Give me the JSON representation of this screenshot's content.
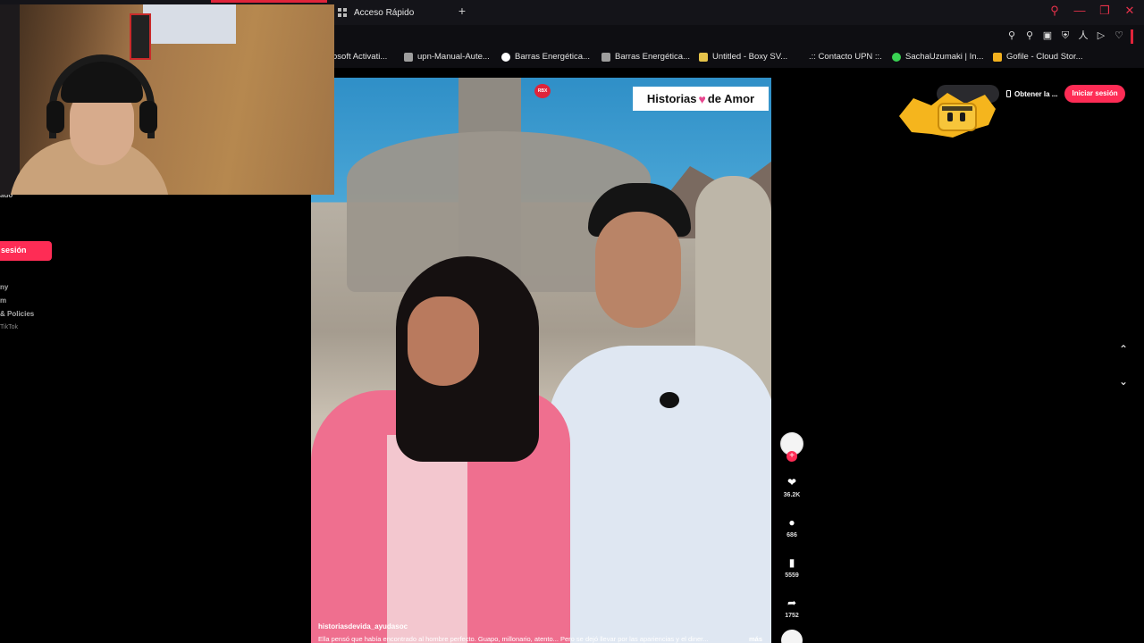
{
  "browser": {
    "tab_label": "Acceso Rápido",
    "new_tab": "+",
    "bookmarks": [
      {
        "label": "osoft Activati...",
        "color": "#3a7bd5"
      },
      {
        "label": "upn-Manual-Aute...",
        "color": "#9e9e9e"
      },
      {
        "label": "Barras Energética...",
        "color": "#ffffff"
      },
      {
        "label": "Barras Energética...",
        "color": "#9e9e9e"
      },
      {
        "label": "Untitled - Boxy SV...",
        "color": "#e5c34a"
      },
      {
        "label": ".:: Contacto UPN ::.",
        "color": "#000000"
      },
      {
        "label": "SachaUzumaki | In...",
        "color": "#39d353"
      },
      {
        "label": "Gofile - Cloud Stor...",
        "color": "#f2b01e"
      }
    ]
  },
  "sidebar": {
    "fragment_top": "ado",
    "login_label": "sesión",
    "links": [
      "ny",
      "m",
      "& Policies"
    ],
    "copyright": "TikTok"
  },
  "video": {
    "badge": "RBX",
    "overlay_title_part1": "Historias",
    "overlay_heart": "♥",
    "overlay_title_part2": "de Amor",
    "username": "historiasdevida_ayudasoc",
    "caption": "Ella pensó que había encontrado al hombre perfecto. Guapo, millonario, atento... Pero se dejó llevar por las apariencias y el diner...",
    "more": "más"
  },
  "actions": {
    "likes": "36.2K",
    "comments": "686",
    "saves": "5559",
    "shares": "1752"
  },
  "topright": {
    "get_app": "Obtener la ...",
    "signin": "Iniciar sesión"
  },
  "colors": {
    "brand": "#fe2c55",
    "browser_accent": "#e0243a"
  }
}
